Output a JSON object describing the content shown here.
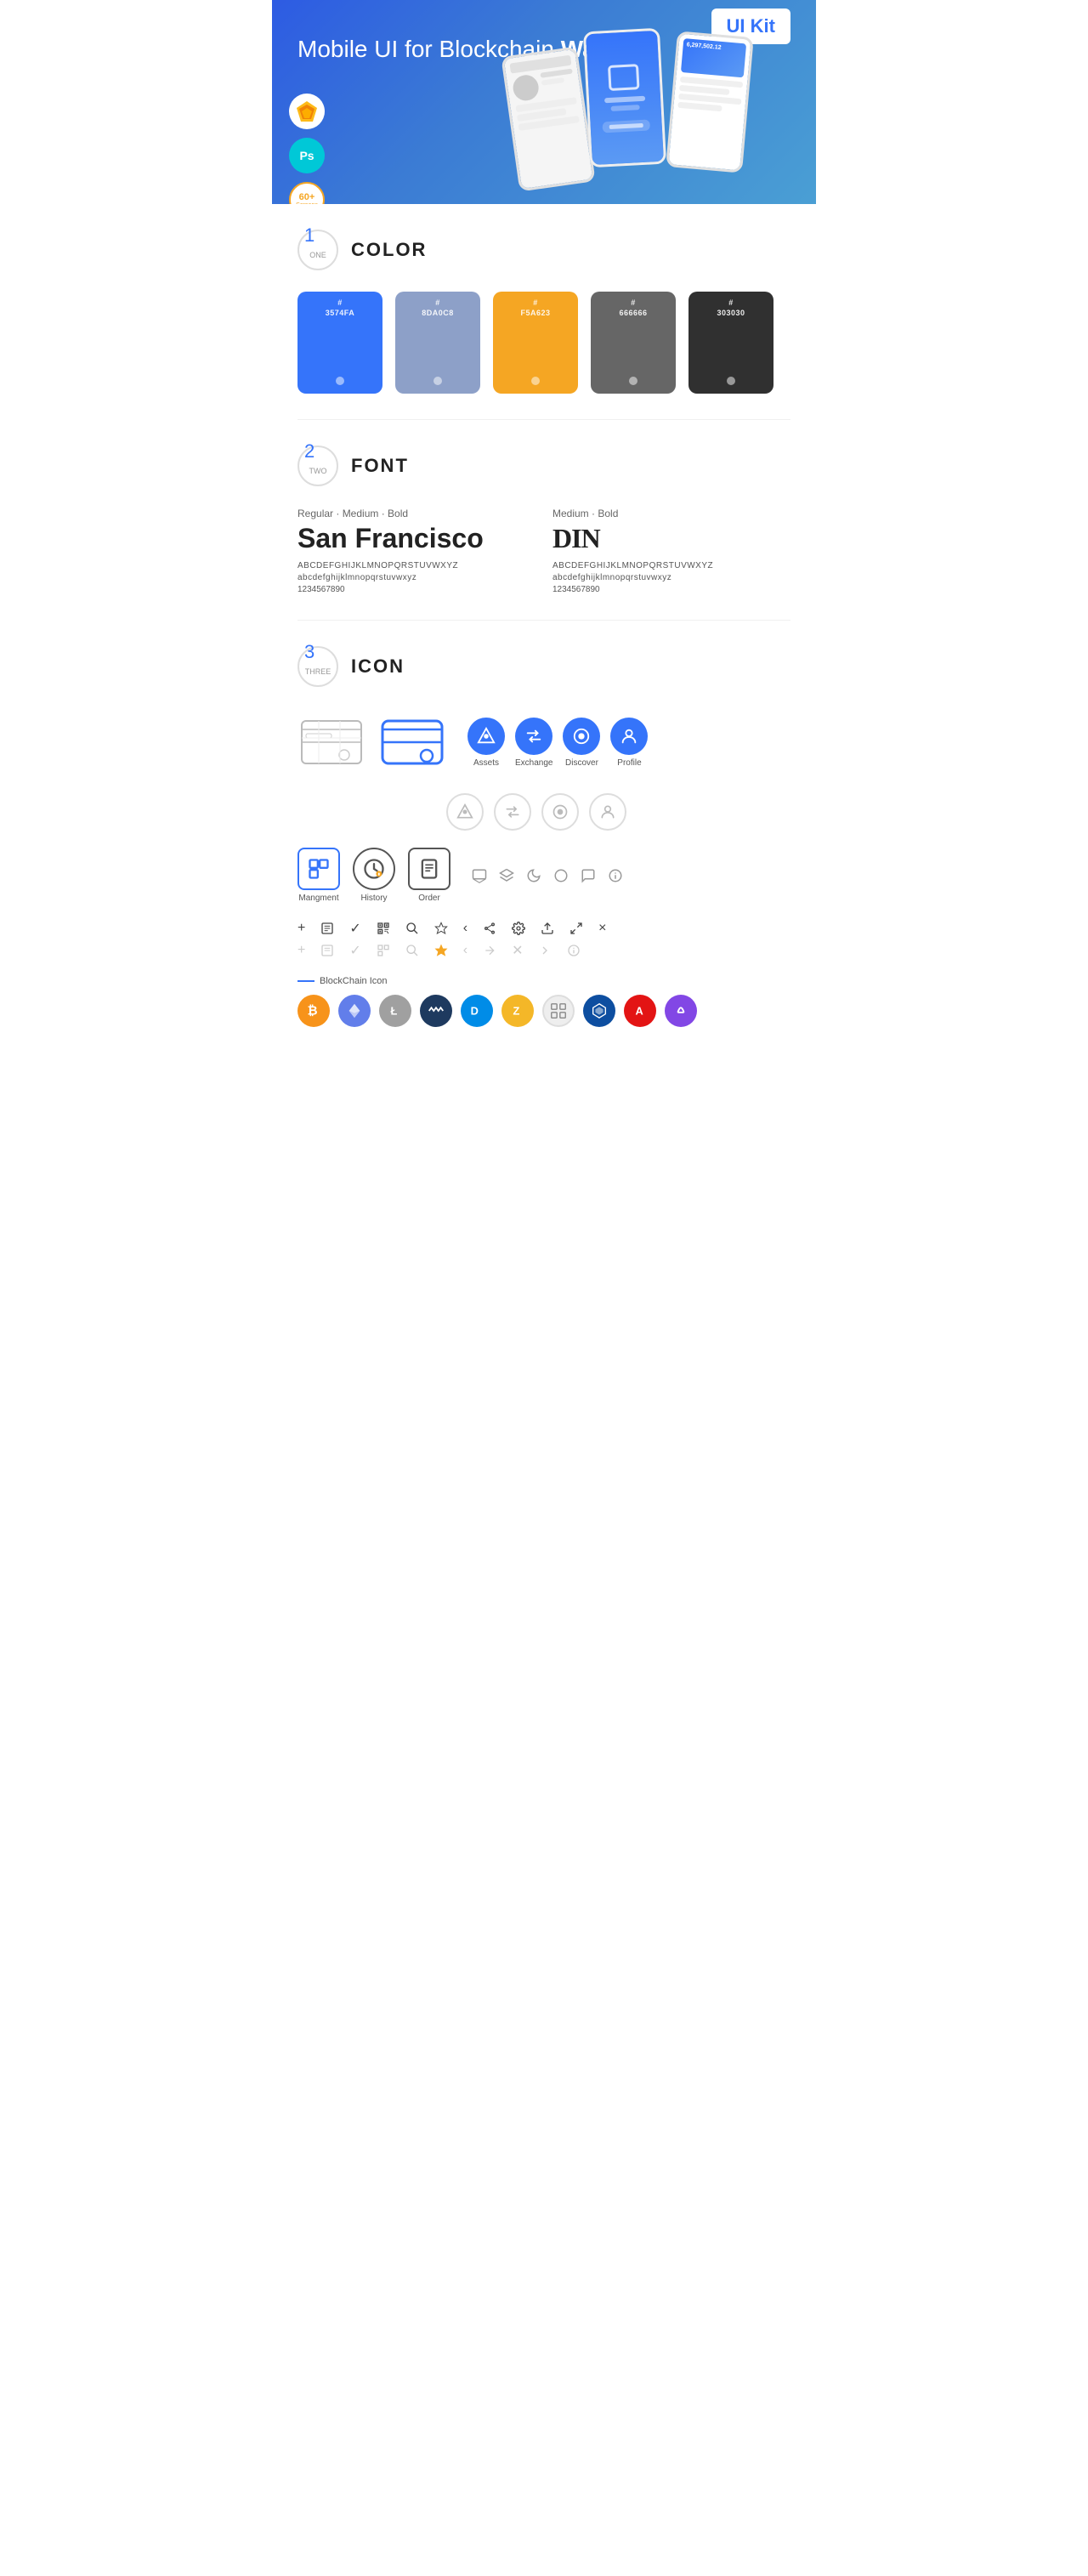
{
  "hero": {
    "title": "Mobile UI for Blockchain ",
    "title_bold": "Wallet",
    "badge": "UI Kit",
    "badge_sketch": "⬡",
    "badge_ps": "Ps",
    "badge_screens_num": "60+",
    "badge_screens_lbl": "Screens"
  },
  "sections": {
    "color": {
      "number": "1",
      "number_sub": "ONE",
      "title": "COLOR",
      "swatches": [
        {
          "hex": "#3574FA",
          "code": "#\n3574FA"
        },
        {
          "hex": "#8DA0C8",
          "code": "#\n8DA0C8"
        },
        {
          "hex": "#F5A623",
          "code": "#\nF5A623"
        },
        {
          "hex": "#666666",
          "code": "#\n666666"
        },
        {
          "hex": "#303030",
          "code": "#\n303030"
        }
      ]
    },
    "font": {
      "number": "2",
      "number_sub": "TWO",
      "title": "FONT",
      "fonts": [
        {
          "style": "Regular · Medium · Bold",
          "name": "San Francisco",
          "uppercase": "ABCDEFGHIJKLMNOPQRSTUVWXYZ",
          "lowercase": "abcdefghijklmnopqrstuvwxyz",
          "numbers": "1234567890"
        },
        {
          "style": "Medium · Bold",
          "name": "DIN",
          "uppercase": "ABCDEFGHIJKLMNOPQRSTUVWXYZ",
          "lowercase": "abcdefghijklmnopqrstuvwxyz",
          "numbers": "1234567890"
        }
      ]
    },
    "icon": {
      "number": "3",
      "number_sub": "THREE",
      "title": "ICON",
      "nav_icons": [
        {
          "label": "Assets",
          "colored": true
        },
        {
          "label": "Exchange",
          "colored": true
        },
        {
          "label": "Discover",
          "colored": true
        },
        {
          "label": "Profile",
          "colored": true
        },
        {
          "label": "Assets",
          "colored": false
        },
        {
          "label": "Exchange",
          "colored": false
        },
        {
          "label": "Discover",
          "colored": false
        },
        {
          "label": "Profile",
          "colored": false
        }
      ],
      "app_icons": [
        {
          "label": "Mangment"
        },
        {
          "label": "History"
        },
        {
          "label": "Order"
        }
      ],
      "blockchain_label": "BlockChain Icon",
      "crypto_icons": [
        {
          "label": "BTC",
          "class": "crypto-btc"
        },
        {
          "label": "ETH",
          "class": "crypto-eth"
        },
        {
          "label": "LTC",
          "class": "crypto-ltc"
        },
        {
          "label": "WAVES",
          "class": "crypto-waves"
        },
        {
          "label": "DASH",
          "class": "crypto-dash"
        },
        {
          "label": "ZEC",
          "class": "crypto-zcash"
        },
        {
          "label": "GRID",
          "class": "crypto-grid"
        },
        {
          "label": "LSK",
          "class": "crypto-lisk"
        },
        {
          "label": "ARK",
          "class": "crypto-ark"
        },
        {
          "label": "MATIC",
          "class": "crypto-matic"
        }
      ]
    }
  }
}
